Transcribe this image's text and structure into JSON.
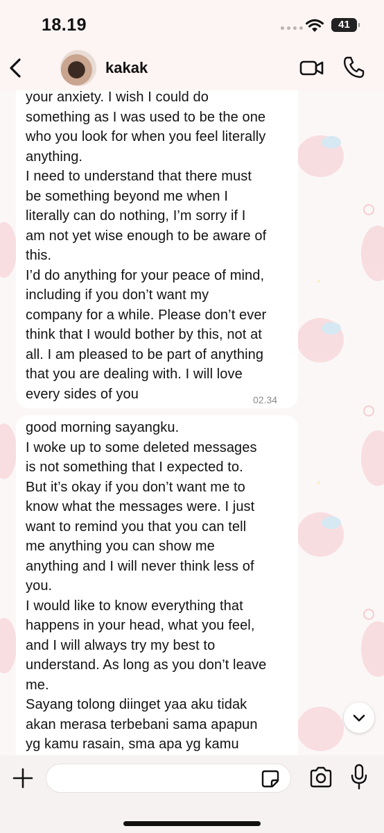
{
  "status_bar": {
    "time": "18.19",
    "battery": "41"
  },
  "header": {
    "contact_name": "kakak"
  },
  "messages": [
    {
      "text": "your anxiety. I wish I could do\nsomething as I was used to be the one\nwho you look for when you feel literally\nanything.\nI need to understand that there must\nbe something beyond me when I\nliterally can do nothing, I’m sorry if I\nam not yet wise enough to be aware of\nthis.\nI’d do anything for your peace of mind,\nincluding if you don’t want my\ncompany for a while. Please don’t ever\nthink that I would bother by this, not at\nall. I am pleased to be part of anything\nthat you are dealing with. I will love\nevery sides of you",
      "time": "02.34"
    },
    {
      "text": "good morning sayangku.\nI woke up to some deleted messages\nis not something that I expected to.\nBut it’s okay if you don’t want me to\nknow what the messages were. I just\nwant to remind you that you can tell\nme anything you can show me\nanything and I will never think less of\nyou.\nI would like to know everything that\nhappens in your head, what you feel,\nand I will always try my best to\nunderstand. As long as you don’t leave\nme.\nSayang tolong diinget yaa aku tidak\nakan merasa terbebani sama apapun\nyg kamu rasain, sma apa yg kamu"
    }
  ],
  "input": {
    "value": "",
    "placeholder": ""
  },
  "icons": {
    "back": "chevron-left-icon",
    "video": "video-camera-icon",
    "phone": "phone-icon",
    "plus": "plus-icon",
    "sticker": "sticker-icon",
    "camera": "camera-icon",
    "mic": "microphone-icon",
    "scroll": "chevron-down-icon"
  },
  "colors": {
    "wallpaper": "#fbf7f7",
    "bubble": "#ffffff",
    "header_bg": "#fdf4f4",
    "deco_pink": "#f2b6be"
  }
}
